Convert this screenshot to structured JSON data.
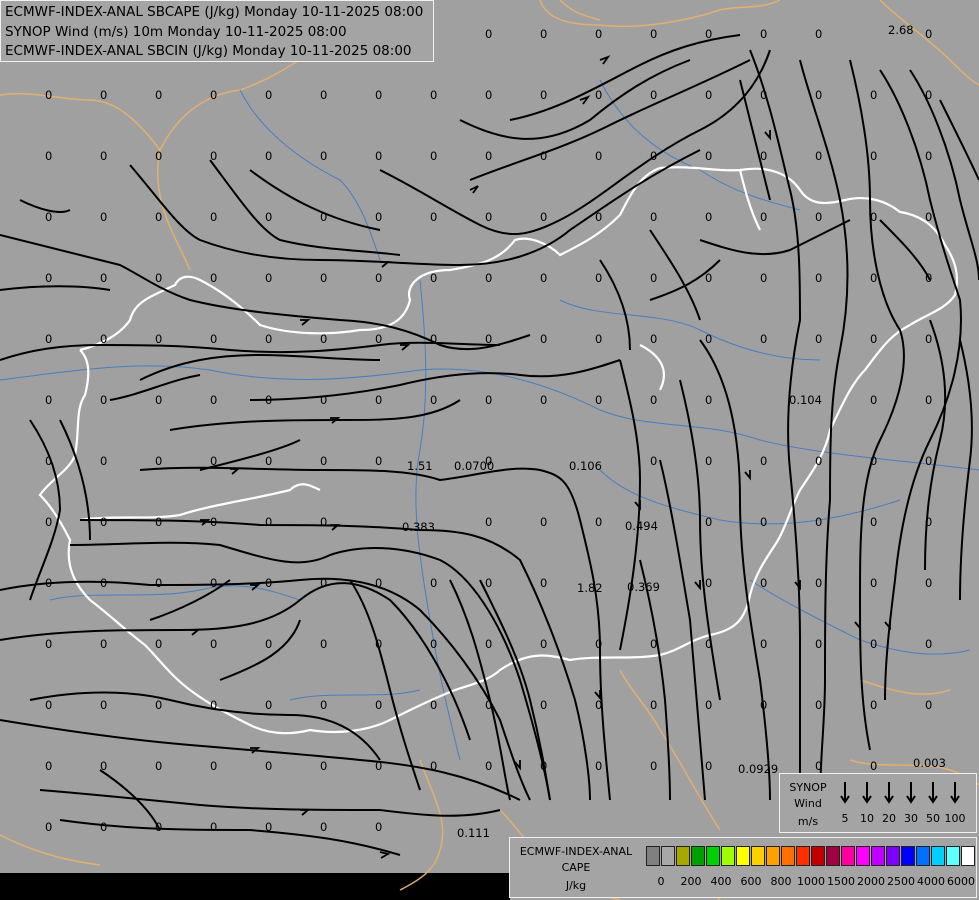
{
  "titles": [
    "ECMWF-INDEX-ANAL SBCAPE (J/kg) Monday 10-11-2025 08:00",
    "SYNOP Wind (m/s) 10m Monday 10-11-2025 08:00",
    "ECMWF-INDEX-ANAL SBCIN (J/kg) Monday 10-11-2025 08:00"
  ],
  "synop_legend": {
    "line1": "SYNOP",
    "line2": "Wind",
    "line3": "m/s",
    "values": [
      "5",
      "10",
      "20",
      "30",
      "50",
      "100"
    ]
  },
  "cape_legend": {
    "line1": "ECMWF-INDEX-ANAL",
    "line2": "CAPE",
    "line3": "J/kg",
    "colors": [
      "#808080",
      "#a8a8a8",
      "#a8a800",
      "#00a000",
      "#00d000",
      "#a0ff00",
      "#ffff00",
      "#ffd000",
      "#ffa000",
      "#ff7000",
      "#ff3000",
      "#c00000",
      "#a00040",
      "#ff00a0",
      "#ff00ff",
      "#c000ff",
      "#8000ff",
      "#0000ff",
      "#0070ff",
      "#00d0ff",
      "#60ffff",
      "#ffffff"
    ],
    "ticks": [
      "0",
      "200",
      "400",
      "600",
      "800",
      "1000",
      "1500",
      "2000",
      "2500",
      "4000",
      "6000"
    ]
  },
  "colors": {
    "background": "#a0a0a0",
    "border": "#ffffff",
    "region_border": "#e0b070",
    "river": "#4a7ec0",
    "streamline": "#000000"
  },
  "values": [
    [
      "2.68",
      "1.51",
      "0.0700",
      "0.106",
      "0.494",
      "0.383",
      "1.82",
      "0.369",
      "0.104",
      "0.0929",
      "0.003",
      "0.111"
    ]
  ]
}
